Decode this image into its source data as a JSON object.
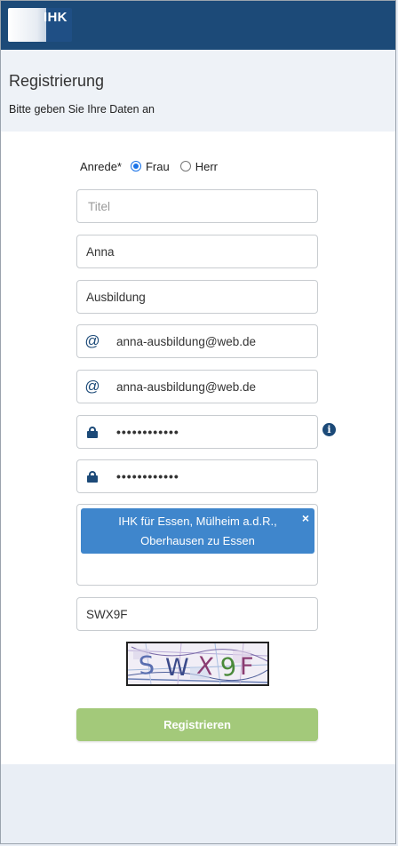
{
  "header": {
    "logo_text": "IHK",
    "brand_color": "#1c4a78"
  },
  "page": {
    "title": "Registrierung",
    "subtitle": "Bitte geben Sie Ihre Daten an"
  },
  "form": {
    "anrede_label": "Anrede*",
    "anrede_options": [
      "Frau",
      "Herr"
    ],
    "anrede_selected": "Frau",
    "titel_placeholder": "Titel",
    "vorname": "Anna",
    "nachname": "Ausbildung",
    "email_icon": "@",
    "email": "anna-ausbildung@web.de",
    "email_confirm": "anna-ausbildung@web.de",
    "password_mask": "••••••••••••",
    "password_confirm_mask": "••••••••••••",
    "info_icon": "i",
    "selected_ihk": "IHK für Essen, Mülheim a.d.R., Oberhausen zu Essen",
    "remove_icon": "×",
    "captcha_input": "SWX9F",
    "captcha_text": "SWX9F",
    "submit_label": "Registrieren",
    "submit_color": "#a3c97a",
    "tag_color": "#3f86cc"
  }
}
